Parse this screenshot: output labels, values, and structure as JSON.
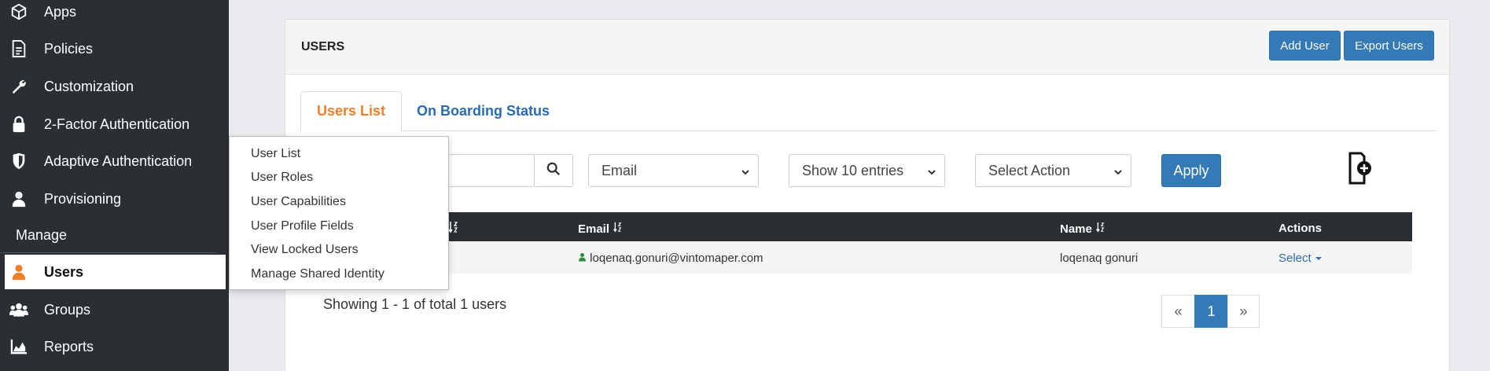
{
  "sidebar": {
    "items": [
      {
        "label": "Apps",
        "icon": "cube-icon"
      },
      {
        "label": "Policies",
        "icon": "document-icon"
      },
      {
        "label": "Customization",
        "icon": "wrench-icon"
      },
      {
        "label": "2-Factor Authentication",
        "icon": "lock-icon"
      },
      {
        "label": "Adaptive Authentication",
        "icon": "shield-icon"
      },
      {
        "label": "Provisioning",
        "icon": "user-icon"
      }
    ],
    "section_label": "Manage",
    "manage_items": [
      {
        "label": "Users",
        "icon": "user-icon",
        "active": true
      },
      {
        "label": "Groups",
        "icon": "users-icon"
      },
      {
        "label": "Reports",
        "icon": "area-chart-icon"
      }
    ]
  },
  "submenu": {
    "items": [
      "User List",
      "User Roles",
      "User Capabilities",
      "User Profile Fields",
      "View Locked Users",
      "Manage Shared Identity"
    ]
  },
  "card": {
    "title": "USERS",
    "add_user_label": "Add User",
    "export_users_label": "Export Users"
  },
  "tabs": {
    "active": "Users List",
    "inactive": "On Boarding Status"
  },
  "filters": {
    "search_value": "",
    "search_by": "Email",
    "entries": "Show 10 entries",
    "action": "Select Action",
    "apply_label": "Apply"
  },
  "table": {
    "headers": [
      "Email",
      "Name",
      "Actions"
    ],
    "rows": [
      {
        "email": "loqenaq.gonuri@vintomaper.com",
        "name": "loqenaq gonuri",
        "action": "Select"
      }
    ]
  },
  "footer": {
    "summary": "Showing 1 - 1 of total 1 users",
    "prev": "«",
    "page": "1",
    "next": "»"
  },
  "colors": {
    "sidebar_bg": "#2a2f33",
    "accent_orange": "#f07f2c",
    "link_blue": "#2a6bb1",
    "primary_button": "#337ab7"
  }
}
